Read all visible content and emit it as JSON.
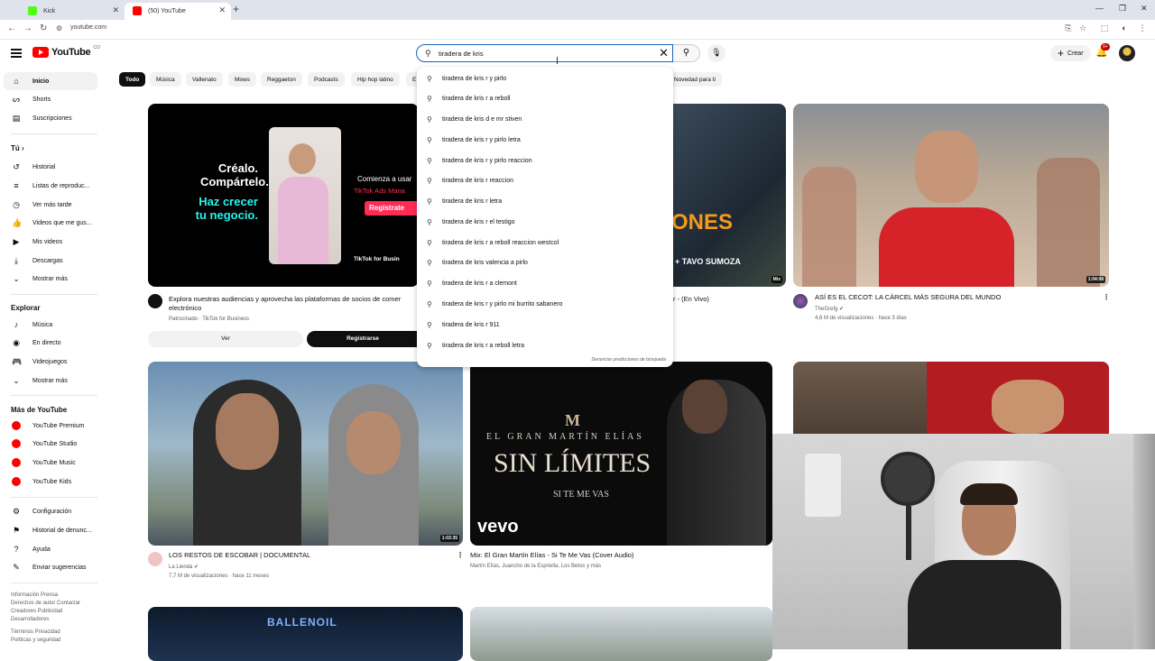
{
  "browser": {
    "tabs": [
      {
        "title": "Kick",
        "active": false,
        "favicon_color": "#53fc18"
      },
      {
        "title": "(50) YouTube",
        "active": true,
        "favicon_color": "#ff0000"
      }
    ],
    "url": "youtube.com"
  },
  "header": {
    "logo_text": "YouTube",
    "logo_country": "CO",
    "search_value": "tiradera de kris",
    "create_label": "Crear",
    "notifications_badge": "9+"
  },
  "sidebar": {
    "main": [
      {
        "label": "Inicio",
        "icon": "home-icon",
        "active": true
      },
      {
        "label": "Shorts",
        "icon": "shorts-icon"
      },
      {
        "label": "Suscripciones",
        "icon": "subscriptions-icon"
      }
    ],
    "you_heading": "Tú",
    "you_items": [
      {
        "label": "Historial",
        "icon": "history-icon"
      },
      {
        "label": "Listas de reproduc...",
        "icon": "playlist-icon"
      },
      {
        "label": "Ver más tarde",
        "icon": "clock-icon"
      },
      {
        "label": "Videos que me gus...",
        "icon": "like-icon"
      },
      {
        "label": "Mis videos",
        "icon": "video-icon"
      },
      {
        "label": "Descargas",
        "icon": "download-icon"
      },
      {
        "label": "Mostrar más",
        "icon": "chevron-down-icon"
      }
    ],
    "explore_heading": "Explorar",
    "explore_items": [
      {
        "label": "Música",
        "icon": "music-icon"
      },
      {
        "label": "En directo",
        "icon": "live-icon"
      },
      {
        "label": "Videojuegos",
        "icon": "gaming-icon"
      },
      {
        "label": "Mostrar más",
        "icon": "chevron-down-icon"
      }
    ],
    "more_heading": "Más de YouTube",
    "more_items": [
      {
        "label": "YouTube Premium",
        "icon": "youtube-premium-icon"
      },
      {
        "label": "YouTube Studio",
        "icon": "youtube-studio-icon"
      },
      {
        "label": "YouTube Music",
        "icon": "youtube-music-icon"
      },
      {
        "label": "YouTube Kids",
        "icon": "youtube-kids-icon"
      }
    ],
    "settings_items": [
      {
        "label": "Configuración",
        "icon": "gear-icon"
      },
      {
        "label": "Historial de denunc...",
        "icon": "flag-icon"
      },
      {
        "label": "Ayuda",
        "icon": "help-icon"
      },
      {
        "label": "Enviar sugerencias",
        "icon": "feedback-icon"
      }
    ],
    "footer_lines": [
      "Información  Prensa",
      "Derechos de autor  Contactar",
      "Creadores  Publicidad",
      "Desarrolladores",
      "",
      "Términos  Privacidad",
      "Políticas y seguridad"
    ]
  },
  "chips": [
    "Todo",
    "Música",
    "Vallenato",
    "Mixes",
    "Reggaeton",
    "Podcasts",
    "Hip hop latino",
    "E",
    "Novedad para ti"
  ],
  "search_suggestions": [
    "tiradera de kris r y pirlo",
    "tiradera de kris r a reboll",
    "tiradera de kris d e mr stiven",
    "tiradera de kris r y pirlo letra",
    "tiradera de kris r y pirlo reaccion",
    "tiradera de kris r reaccion",
    "tiradera de kris r letra",
    "tiradera de kris r el testigo",
    "tiradera de kris r a reboll reaccion westcol",
    "tiradera de kris valencia a pirlo",
    "tiradera de kris r a clemont",
    "tiradera de kris r y pirlo mi burrito sabanero",
    "tiradera de kris r 911",
    "tiradera de kris r a reboll letra"
  ],
  "report_predictions": "Denunciar predicciones de búsqueda",
  "ad": {
    "text1": "Créalo.",
    "text2": "Compártelo.",
    "text3": "Haz crecer",
    "text4": "tu negocio.",
    "cta_small": "Comienza a usar",
    "brand_line": "TikTok Ads Mana",
    "register_btn": "Regístrate",
    "tiktok_label": "TikTok for Busin",
    "title": "Explora nuestras audiencias y aprovecha las plataformas de socios de comer electrónico",
    "sponsor": "Patrocinado · TikTok for Business",
    "view_btn": "Ver",
    "signup_btn": "Registrarse"
  },
  "videos": [
    {
      "title": "r - (En Vivo)",
      "thumb_text": "ONES",
      "thumb_sub": "+ TAVO SUMOZA",
      "duration": "Mix"
    },
    {
      "title": "ASÍ ES EL CECOT: LA CÁRCEL MÁS SEGURA DEL MUNDO",
      "channel": "TheGrefg",
      "meta": "4,6 M de visualizaciones · hace 3 días",
      "duration": "1:04:08"
    },
    {
      "title": "LOS RESTOS DE ESCOBAR | DOCUMENTAL",
      "channel": "La Lienda",
      "meta": "7,7 M de visualizaciones · hace 11 meses",
      "duration": "1:03:35"
    },
    {
      "title": "Mix: El Gran Martín Elías - Si Te Me Vas (Cover Audio)",
      "channel": "Martín Elías, Juancho de la Espriella, Los Betos y más",
      "thumb_small": "EL GRAN MARTÍN ELÍAS",
      "thumb_big": "SIN LÍMITES",
      "thumb_sub": "SI TE ME VAS",
      "thumb_logo": "vevo"
    },
    {
      "title": "",
      "thumb_text": "BALLENOIL"
    }
  ],
  "colors": {
    "accent": "#ff0000",
    "search_border": "#1c62b9",
    "chip_active": "#0f0f0f",
    "register": "#fe2c55"
  }
}
